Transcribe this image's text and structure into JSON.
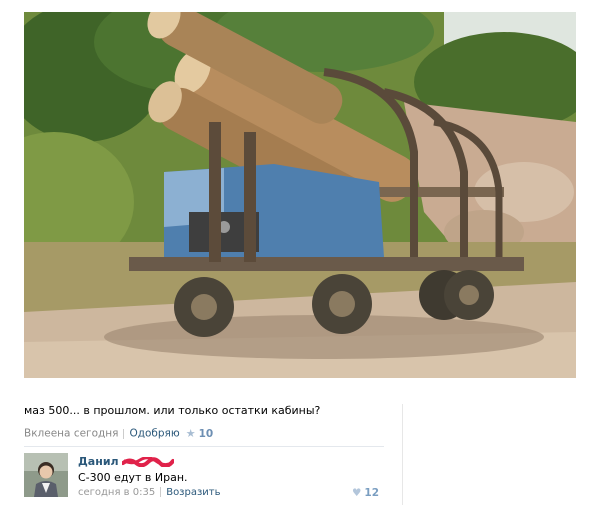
{
  "post": {
    "text": "маз 500... в прошлом. или только остатки кабины?",
    "meta": {
      "posted": "Вклеена сегодня",
      "like_label": "Одобряю",
      "like_count": "10"
    }
  },
  "comment": {
    "author": "Данил",
    "text": "С-300 едут в Иран.",
    "time": "сегодня в 0:35",
    "reply_label": "Возразить",
    "like_count": "12"
  },
  "colors": {
    "link": "#2b587a",
    "muted": "#888888",
    "like": "#7a9ec1"
  },
  "icons": [
    "star-icon",
    "heart-icon"
  ]
}
